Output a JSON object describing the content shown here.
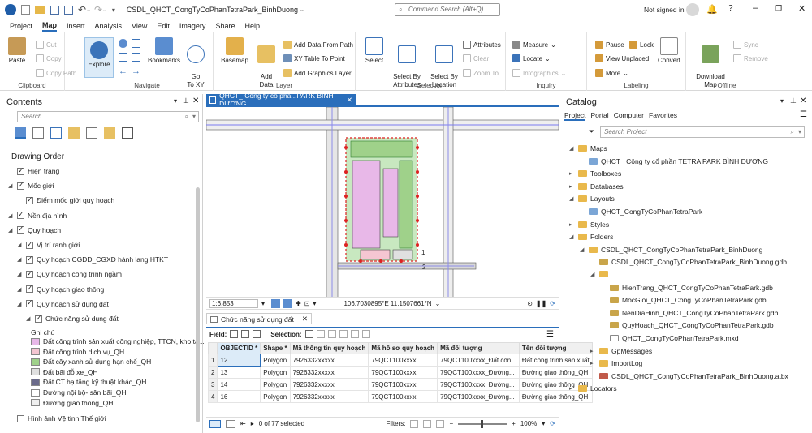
{
  "titlebar": {
    "doc_title": "CSDL_QHCT_CongTyCoPhanTetraPark_BinhDuong",
    "command_search": "Command Search (Alt+Q)",
    "signin": "Not signed in"
  },
  "menu": [
    "Project",
    "Map",
    "Insert",
    "Analysis",
    "View",
    "Edit",
    "Imagery",
    "Share",
    "Help"
  ],
  "ribbon": {
    "clipboard": {
      "paste": "Paste",
      "cut": "Cut",
      "copy": "Copy",
      "copy_path": "Copy Path",
      "label": "Clipboard"
    },
    "navigate": {
      "explore": "Explore",
      "bookmarks": "Bookmarks",
      "goto": "Go\nTo XY",
      "label": "Navigate"
    },
    "layer": {
      "basemap": "Basemap",
      "add_data": "Add\nData",
      "add_from_path": "Add Data From Path",
      "xy_table": "XY Table To Point",
      "add_graphics": "Add Graphics Layer",
      "label": "Layer"
    },
    "selection": {
      "select": "Select",
      "select_by_attr": "Select By\nAttributes",
      "select_by_loc": "Select By\nLocation",
      "attributes": "Attributes",
      "clear": "Clear",
      "zoom_to": "Zoom To",
      "label": "Selection"
    },
    "inquiry": {
      "measure": "Measure",
      "locate": "Locate",
      "infographics": "Infographics",
      "label": "Inquiry"
    },
    "labeling": {
      "pause": "Pause",
      "lock": "Lock",
      "view_unplaced": "View Unplaced",
      "more": "More",
      "convert": "Convert",
      "label": "Labeling"
    },
    "offline": {
      "download_map": "Download\nMap",
      "sync": "Sync",
      "remove": "Remove",
      "label": "Offline"
    }
  },
  "contents": {
    "title": "Contents",
    "search_placeholder": "Search",
    "drawing_order": "Drawing Order",
    "layers": [
      {
        "label": "Hiện trạng",
        "indent": 0,
        "tri": false
      },
      {
        "label": "Mốc giới",
        "indent": 0,
        "tri": true
      },
      {
        "label": "Điểm mốc giới quy hoạch",
        "indent": 1,
        "tri": false
      },
      {
        "label": "Nền địa hình",
        "indent": 0,
        "tri": true
      },
      {
        "label": "Quy hoạch",
        "indent": 0,
        "tri": true
      },
      {
        "label": "Vị trí ranh giới",
        "indent": 1,
        "tri": true
      },
      {
        "label": "Quy hoạch CGDD_CGXD hành lang HTKT",
        "indent": 1,
        "tri": true
      },
      {
        "label": "Quy hoạch công trình ngầm",
        "indent": 1,
        "tri": true
      },
      {
        "label": "Quy hoạch giao thông",
        "indent": 1,
        "tri": true
      },
      {
        "label": "Quy hoạch sử dụng đất",
        "indent": 1,
        "tri": true
      },
      {
        "label": "Chức năng sử dụng đất",
        "indent": 2,
        "tri": true
      }
    ],
    "legend_title": "Ghi chú",
    "legend": [
      {
        "label": "Đất công trình sản xuất công nghiệp, TTCN, kho tà...",
        "color": "#e8b8e8"
      },
      {
        "label": "Đất công trình dịch vụ_QH",
        "color": "#f5c6d2"
      },
      {
        "label": "Đất cây xanh sử dụng hạn chế_QH",
        "color": "#9fd18a"
      },
      {
        "label": "Đất bãi đỗ xe_QH",
        "color": "#e0e0e0"
      },
      {
        "label": "Đất CT hạ tầng kỹ thuật khác_QH",
        "color": "#6a6a8a"
      },
      {
        "label": "Đường nội bộ- sân bãi_QH",
        "color": "#ffffff"
      },
      {
        "label": "Đường giao thông_QH",
        "color": "#f0f0f0"
      }
    ],
    "satellite": "Hình ảnh Vệ tinh Thế giới"
  },
  "map": {
    "tab_title": "QHCT_ Công ty cổ phầ...PARK BÌNH DƯƠNG",
    "scale": "1:6,853",
    "coords": "106.7030895°E 11.1507661°N",
    "label_1": "1",
    "label_2": "2"
  },
  "table": {
    "tab_title": "Chức năng sử dụng đất",
    "field_label": "Field:",
    "selection_label": "Selection:",
    "columns": [
      "OBJECTID *",
      "Shape *",
      "Mã thông tin quy hoạch",
      "Mã hồ sơ quy hoạch",
      "Mã đối tượng",
      "Tên đối tượng"
    ],
    "rows": [
      [
        "1",
        "12",
        "Polygon",
        "7926332xxxxx",
        "79QCT100xxxx",
        "79QCT100xxxx_Đất côn...",
        "Đất công trình sản xuất"
      ],
      [
        "2",
        "13",
        "Polygon",
        "7926332xxxxx",
        "79QCT100xxxx",
        "79QCT100xxxx_Đường...",
        "Đường giao thông_QH"
      ],
      [
        "3",
        "14",
        "Polygon",
        "7926332xxxxx",
        "79QCT100xxxx",
        "79QCT100xxxx_Đường...",
        "Đường giao thông_QH"
      ],
      [
        "4",
        "16",
        "Polygon",
        "7926332xxxxx",
        "79QCT100xxxx",
        "79QCT100xxxx_Đường...",
        "Đường giao thông_QH"
      ]
    ],
    "status": "0 of 77 selected",
    "filters": "Filters:",
    "zoom": "100%"
  },
  "catalog": {
    "title": "Catalog",
    "tabs": [
      "Project",
      "Portal",
      "Computer",
      "Favorites"
    ],
    "search_placeholder": "Search Project",
    "items": [
      {
        "label": "Maps",
        "indent": 0,
        "kind": "folder",
        "open": true
      },
      {
        "label": "QHCT_ Công ty cổ phần TETRA PARK BÌNH DƯƠNG",
        "indent": 1,
        "kind": "map"
      },
      {
        "label": "Toolboxes",
        "indent": 0,
        "kind": "folder",
        "open": false
      },
      {
        "label": "Databases",
        "indent": 0,
        "kind": "folder",
        "open": false
      },
      {
        "label": "Layouts",
        "indent": 0,
        "kind": "folder",
        "open": true
      },
      {
        "label": "QHCT_CongTyCoPhanTetraPark",
        "indent": 1,
        "kind": "map"
      },
      {
        "label": "Styles",
        "indent": 0,
        "kind": "folder",
        "open": false
      },
      {
        "label": "Folders",
        "indent": 0,
        "kind": "folder",
        "open": true
      },
      {
        "label": "CSDL_QHCT_CongTyCoPhanTetraPark_BinhDuong",
        "indent": 1,
        "kind": "folder",
        "open": true
      },
      {
        "label": "CSDL_QHCT_CongTyCoPhanTetraPark_BinhDuong.gdb",
        "indent": 2,
        "kind": "gdb"
      },
      {
        "label": "",
        "indent": 2,
        "kind": "folder",
        "open": true
      },
      {
        "label": "HienTrang_QHCT_CongTyCoPhanTetraPark.gdb",
        "indent": 3,
        "kind": "gdb"
      },
      {
        "label": "MocGioi_QHCT_CongTyCoPhanTetraPark.gdb",
        "indent": 3,
        "kind": "gdb"
      },
      {
        "label": "NenDiaHinh_QHCT_CongTyCoPhanTetraPark.gdb",
        "indent": 3,
        "kind": "gdb"
      },
      {
        "label": "QuyHoach_QHCT_CongTyCoPhanTetraPark.gdb",
        "indent": 3,
        "kind": "gdb"
      },
      {
        "label": "QHCT_CongTyCoPhanTetraPark.mxd",
        "indent": 3,
        "kind": "file"
      },
      {
        "label": "GpMessages",
        "indent": 2,
        "kind": "folder",
        "open": false
      },
      {
        "label": "ImportLog",
        "indent": 2,
        "kind": "folder",
        "open": false
      },
      {
        "label": "CSDL_QHCT_CongTyCoPhanTetraPark_BinhDuong.atbx",
        "indent": 2,
        "kind": "toolbox"
      },
      {
        "label": "Locators",
        "indent": 0,
        "kind": "folder",
        "open": false
      }
    ]
  }
}
